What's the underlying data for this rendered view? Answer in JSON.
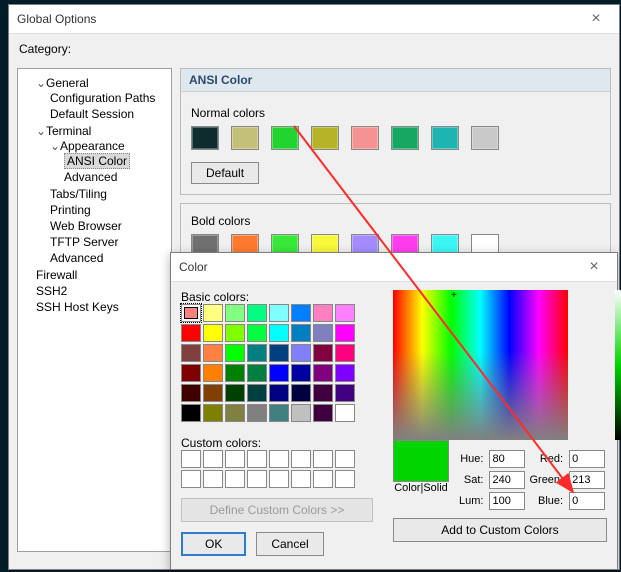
{
  "main_window": {
    "title": "Global Options",
    "category_label": "Category:",
    "tree": {
      "general": "General",
      "config_paths": "Configuration Paths",
      "default_session": "Default Session",
      "terminal": "Terminal",
      "appearance": "Appearance",
      "ansi_color": "ANSI Color",
      "advanced_app": "Advanced",
      "tabs": "Tabs/Tiling",
      "printing": "Printing",
      "web": "Web Browser",
      "tftp": "TFTP Server",
      "advanced_term": "Advanced",
      "firewall": "Firewall",
      "ssh2": "SSH2",
      "ssh_keys": "SSH Host Keys"
    },
    "panel": {
      "title": "ANSI Color",
      "normal_label": "Normal colors",
      "normal_colors": [
        "#0e2b2e",
        "#c4c07a",
        "#22d430",
        "#b5b327",
        "#f59393",
        "#14a860",
        "#1eb5b1",
        "#c9c9c9"
      ],
      "default_btn": "Default",
      "bold_label": "Bold colors",
      "bold_colors": [
        "#707070",
        "#ff7a2e",
        "#38e838",
        "#f8f83a",
        "#a38cff",
        "#ff3cf0",
        "#3cf6f6",
        "#ffffff"
      ]
    }
  },
  "color_dialog": {
    "title": "Color",
    "basic_label": "Basic colors:",
    "basic_colors": [
      "#ff8080",
      "#ffff80",
      "#80ff80",
      "#00ff80",
      "#80ffff",
      "#0080ff",
      "#ff80c0",
      "#ff80ff",
      "#ff0000",
      "#ffff00",
      "#80ff00",
      "#00ff40",
      "#00ffff",
      "#0080c0",
      "#8080c0",
      "#ff00ff",
      "#804040",
      "#ff8040",
      "#00ff00",
      "#008080",
      "#004080",
      "#8080ff",
      "#800040",
      "#ff0080",
      "#800000",
      "#ff8000",
      "#008000",
      "#008040",
      "#0000ff",
      "#0000a0",
      "#800080",
      "#8000ff",
      "#400000",
      "#804000",
      "#004000",
      "#004040",
      "#000080",
      "#000040",
      "#400040",
      "#400080",
      "#000000",
      "#808000",
      "#808040",
      "#808080",
      "#408080",
      "#c0c0c0",
      "#400040",
      "#ffffff"
    ],
    "selected_basic": 0,
    "custom_label": "Custom colors:",
    "define_btn": "Define Custom Colors >>",
    "ok": "OK",
    "cancel": "Cancel",
    "hue_lbl": "Hue:",
    "sat_lbl": "Sat:",
    "lum_lbl": "Lum:",
    "red_lbl": "Red:",
    "green_lbl": "Green:",
    "blue_lbl": "Blue:",
    "hue": "80",
    "sat": "240",
    "lum": "100",
    "red": "0",
    "green": "213",
    "blue": "0",
    "color_solid": "Color|Solid",
    "add_btn": "Add to Custom Colors"
  }
}
